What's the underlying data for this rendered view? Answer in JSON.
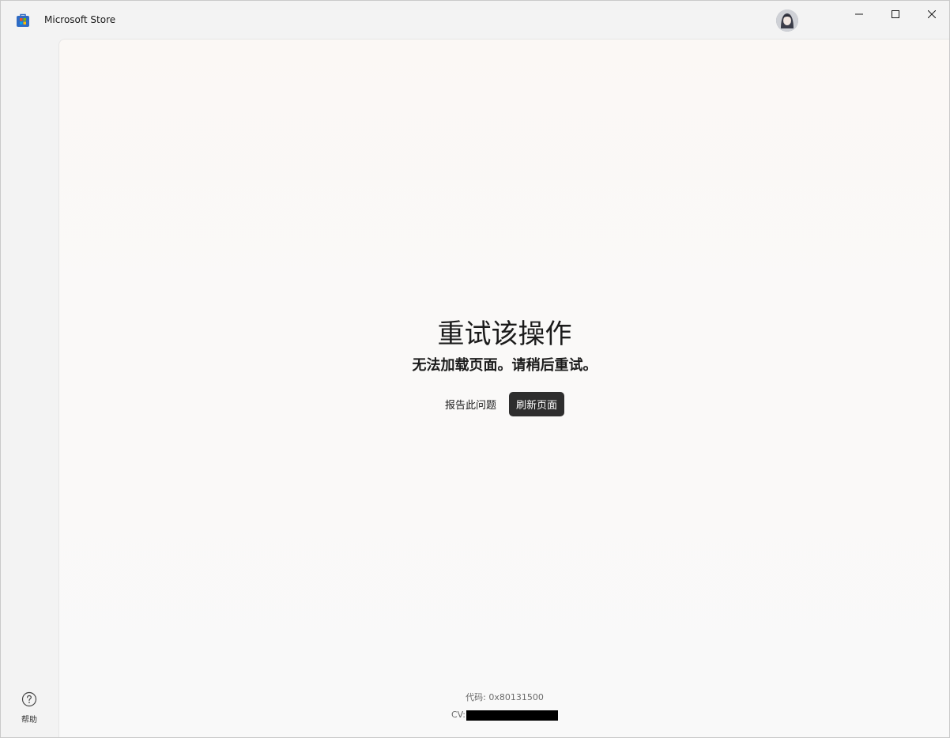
{
  "window": {
    "app_title": "Microsoft Store",
    "app_icon": "microsoft-store-icon"
  },
  "titlebar": {
    "avatar": "user-avatar",
    "controls": [
      "minimize",
      "maximize",
      "close"
    ]
  },
  "sidebar": {
    "help_label": "帮助",
    "help_icon": "question-circle-icon"
  },
  "error": {
    "title": "重试该操作",
    "subtitle": "无法加载页面。请稍后重试。",
    "report_label": "报告此问题",
    "refresh_label": "刷新页面"
  },
  "footer": {
    "code": "代码: 0x80131500",
    "cv_label": "CV:"
  },
  "colors": {
    "accent_button": "#2e2e2e",
    "background": "#f9f9f9"
  }
}
